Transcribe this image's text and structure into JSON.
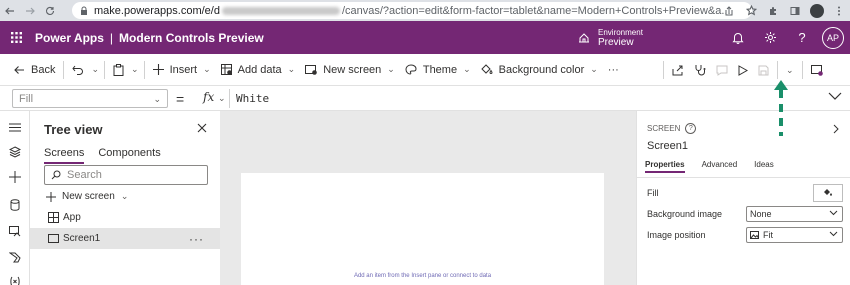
{
  "browser": {
    "url_host": "make.powerapps.com/e/d",
    "url_rest": "/canvas/?action=edit&form-factor=tablet&name=Modern+Controls+Preview&a..."
  },
  "header": {
    "brand": "Power Apps",
    "divider": "|",
    "app_name": "Modern Controls Preview",
    "environment_label": "Environment",
    "environment_name": "Preview",
    "avatar_initials": "AP"
  },
  "commands": {
    "back": "Back",
    "insert": "Insert",
    "add_data": "Add data",
    "new_screen": "New screen",
    "theme": "Theme",
    "background_color": "Background color",
    "more": "···"
  },
  "formula_bar": {
    "property": "Fill",
    "equals": "=",
    "fx": "fx",
    "formula": "White"
  },
  "tree_view": {
    "title": "Tree view",
    "tabs": [
      "Screens",
      "Components"
    ],
    "search_placeholder": "Search",
    "new_screen": "New screen",
    "nodes": [
      {
        "label": "App"
      },
      {
        "label": "Screen1"
      }
    ],
    "more": "···"
  },
  "canvas": {
    "hint": "Add an item from the Insert pane or connect to data"
  },
  "properties": {
    "kind": "SCREEN",
    "help": "?",
    "name": "Screen1",
    "tabs": [
      "Properties",
      "Advanced",
      "Ideas"
    ],
    "rows": {
      "fill": "Fill",
      "background_image": "Background image",
      "background_image_value": "None",
      "image_position": "Image position",
      "image_position_value": "Fit"
    }
  },
  "colors": {
    "header_bg": "#742774",
    "accent": "#742774",
    "annotation_arrow": "#1a8f6a"
  }
}
